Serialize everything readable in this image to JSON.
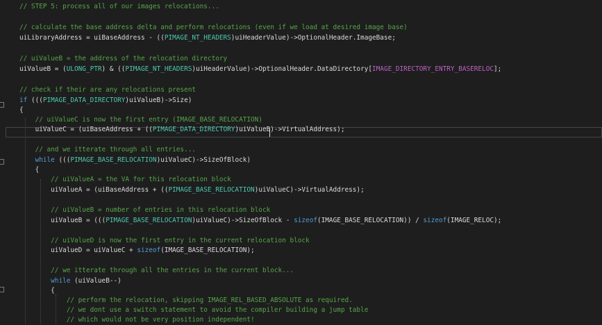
{
  "editor": {
    "lines": [
      {
        "tokens": [
          {
            "t": "// STEP 5: process all of our images relocations...",
            "c": "comment"
          }
        ]
      },
      {
        "tokens": [
          {
            "t": "// calculate the base address delta and perform relocations (even if we load at desired image base)",
            "c": "comment"
          }
        ]
      },
      {
        "tokens": [
          {
            "t": "uiLibraryAddress = uiBaseAddress - ((",
            "c": "plain"
          },
          {
            "t": "PIMAGE_NT_HEADERS",
            "c": "type"
          },
          {
            "t": ")uiHeaderValue)->OptionalHeader.ImageBase;",
            "c": "plain"
          }
        ]
      },
      {
        "tokens": [
          {
            "t": "// uiValueB = the address of the relocation directory",
            "c": "comment"
          }
        ]
      },
      {
        "tokens": [
          {
            "t": "uiValueB = (",
            "c": "plain"
          },
          {
            "t": "ULONG_PTR",
            "c": "type"
          },
          {
            "t": ") & ((",
            "c": "plain"
          },
          {
            "t": "PIMAGE_NT_HEADERS",
            "c": "type"
          },
          {
            "t": ")uiHeaderValue)->OptionalHeader.DataDirectory[",
            "c": "plain"
          },
          {
            "t": "IMAGE_DIRECTORY_ENTRY_BASERELOC",
            "c": "macro"
          },
          {
            "t": "];",
            "c": "plain"
          }
        ]
      },
      {
        "tokens": [
          {
            "t": "// check if their are any relocations present",
            "c": "comment"
          }
        ]
      },
      {
        "tokens": [
          {
            "t": "if",
            "c": "keyword"
          },
          {
            "t": " (((",
            "c": "plain"
          },
          {
            "t": "PIMAGE_DATA_DIRECTORY",
            "c": "type"
          },
          {
            "t": ")uiValueB)->Size)",
            "c": "plain"
          }
        ]
      },
      {
        "tokens": [
          {
            "t": "{",
            "c": "plain"
          }
        ]
      },
      {
        "tokens": [
          {
            "t": "    // uiValueC is now the first entry (IMAGE_BASE_RELOCATION)",
            "c": "comment"
          }
        ]
      },
      {
        "tokens": [
          {
            "t": "    uiValueC = (uiBaseAddress + ((",
            "c": "plain"
          },
          {
            "t": "PIMAGE_DATA_DIRECTORY",
            "c": "type"
          },
          {
            "t": ")uiValueB)->VirtualAddress);",
            "c": "plain"
          }
        ]
      },
      {
        "tokens": [
          {
            "t": "    // and we itterate through all entries...",
            "c": "comment"
          }
        ]
      },
      {
        "tokens": [
          {
            "t": "    ",
            "c": "plain"
          },
          {
            "t": "while",
            "c": "keyword"
          },
          {
            "t": " (((",
            "c": "plain"
          },
          {
            "t": "PIMAGE_BASE_RELOCATION",
            "c": "type"
          },
          {
            "t": ")uiValueC)->SizeOfBlock)",
            "c": "plain"
          }
        ]
      },
      {
        "tokens": [
          {
            "t": "    {",
            "c": "plain"
          }
        ]
      },
      {
        "tokens": [
          {
            "t": "        // uiValueA = the VA for this relocation block",
            "c": "comment"
          }
        ]
      },
      {
        "tokens": [
          {
            "t": "        uiValueA = (uiBaseAddress + ((",
            "c": "plain"
          },
          {
            "t": "PIMAGE_BASE_RELOCATION",
            "c": "type"
          },
          {
            "t": ")uiValueC)->VirtualAddress);",
            "c": "plain"
          }
        ]
      },
      {
        "tokens": [
          {
            "t": "        // uiValueB = number of entries in this relocation block",
            "c": "comment"
          }
        ]
      },
      {
        "tokens": [
          {
            "t": "        uiValueB = (((",
            "c": "plain"
          },
          {
            "t": "PIMAGE_BASE_RELOCATION",
            "c": "type"
          },
          {
            "t": ")uiValueC)->SizeOfBlock - ",
            "c": "plain"
          },
          {
            "t": "sizeof",
            "c": "keyword"
          },
          {
            "t": "(IMAGE_BASE_RELOCATION)) / ",
            "c": "plain"
          },
          {
            "t": "sizeof",
            "c": "keyword"
          },
          {
            "t": "(IMAGE_RELOC);",
            "c": "plain"
          }
        ]
      },
      {
        "tokens": [
          {
            "t": "        // uiValueD is now the first entry in the current relocation block",
            "c": "comment"
          }
        ]
      },
      {
        "tokens": [
          {
            "t": "        uiValueD = uiValueC + ",
            "c": "plain"
          },
          {
            "t": "sizeof",
            "c": "keyword"
          },
          {
            "t": "(IMAGE_BASE_RELOCATION);",
            "c": "plain"
          }
        ]
      },
      {
        "tokens": [
          {
            "t": "        // we itterate through all the entries in the current block...",
            "c": "comment"
          }
        ]
      },
      {
        "tokens": [
          {
            "t": "        ",
            "c": "plain"
          },
          {
            "t": "while",
            "c": "keyword"
          },
          {
            "t": " (uiValueB--)",
            "c": "plain"
          }
        ]
      },
      {
        "tokens": [
          {
            "t": "        {",
            "c": "plain"
          }
        ]
      },
      {
        "tokens": [
          {
            "t": "            // perform the relocation, skipping IMAGE_REL_BASED_ABSOLUTE as required.",
            "c": "comment"
          }
        ]
      },
      {
        "tokens": [
          {
            "t": "            // we dont use a switch statement to avoid the compiler building a jump table",
            "c": "comment"
          }
        ]
      },
      {
        "tokens": [
          {
            "t": "            // which would not be very position independent!",
            "c": "comment"
          }
        ]
      }
    ]
  }
}
